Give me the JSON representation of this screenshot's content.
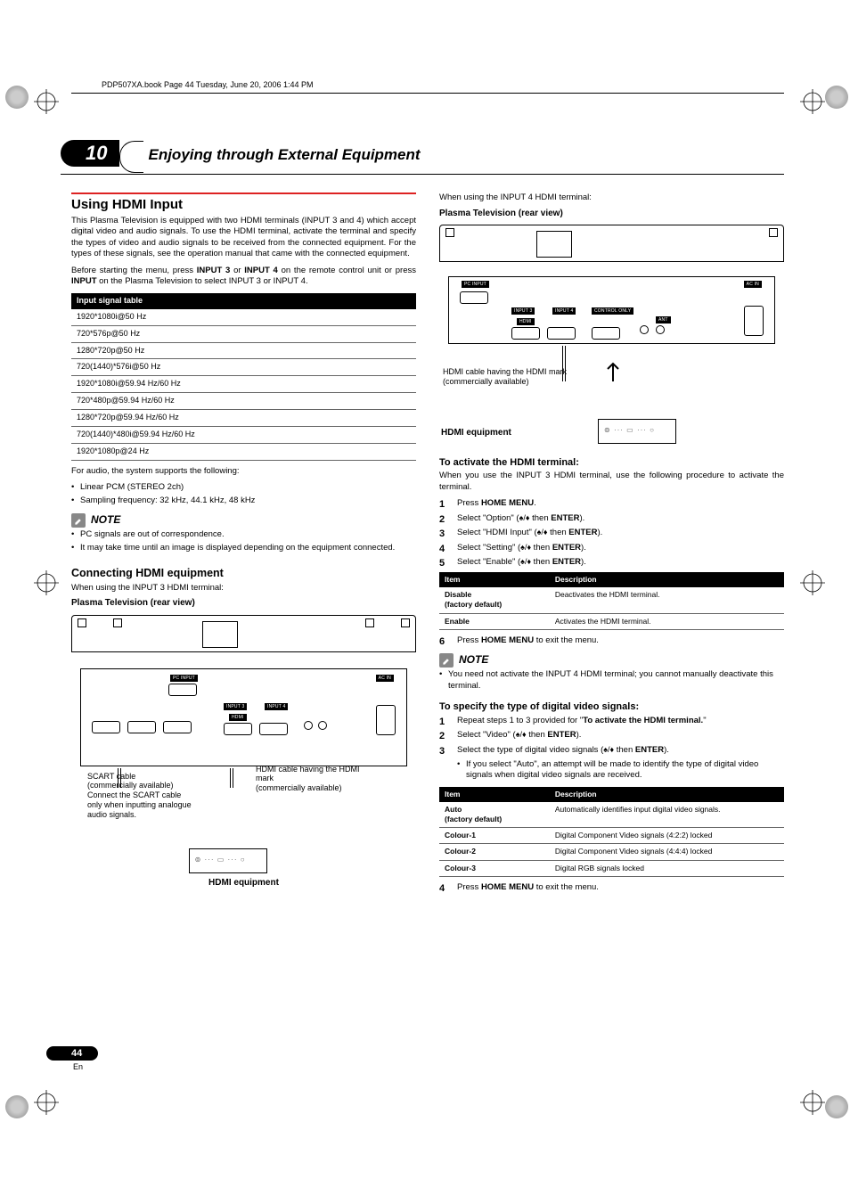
{
  "meta": {
    "tab_line": "PDP507XA.book  Page 44  Tuesday, June 20, 2006  1:44 PM"
  },
  "chapter": {
    "number": "10",
    "title": "Enjoying through External Equipment"
  },
  "left": {
    "h2": "Using HDMI Input",
    "intro": "This Plasma Television is equipped with two HDMI terminals (INPUT 3 and 4) which accept digital video and audio signals. To use the HDMI terminal, activate the terminal and specify the types of video and audio signals to be received from the connected equipment. For the types of these signals, see the operation manual that came with the connected equipment.",
    "before_pre": "Before starting the menu, press ",
    "before_b1": "INPUT 3",
    "before_mid": " or ",
    "before_b2": "INPUT 4",
    "before_mid2": " on the remote control unit or press ",
    "before_b3": "INPUT",
    "before_end": " on the Plasma Television to select INPUT 3 or INPUT 4.",
    "sig_header": "Input signal table",
    "sig_rows": [
      "1920*1080i@50 Hz",
      "720*576p@50 Hz",
      "1280*720p@50 Hz",
      "720(1440)*576i@50 Hz",
      "1920*1080i@59.94 Hz/60 Hz",
      "720*480p@59.94 Hz/60 Hz",
      "1280*720p@59.94 Hz/60 Hz",
      "720(1440)*480i@59.94 Hz/60 Hz",
      "1920*1080p@24 Hz"
    ],
    "after_table": "For audio, the system supports the following:",
    "audio_bullets": [
      "Linear PCM (STEREO 2ch)",
      "Sampling frequency: 32 kHz, 44.1 kHz, 48 kHz"
    ],
    "note_label": "NOTE",
    "note_bullets": [
      "PC signals are out of correspondence.",
      "It may take time until an image is displayed depending on the equipment connected."
    ],
    "h3_connect": "Connecting HDMI equipment",
    "when3": "When using the INPUT 3 HDMI terminal:",
    "diag_caption": "Plasma Television (rear view)",
    "pc_input_lbl": "PC INPUT",
    "input3_lbl": "INPUT 3",
    "input4_lbl": "INPUT 4",
    "hdmi_lbl": "HDMI",
    "acin_lbl": "AC IN",
    "scart_caption": "SCART cable\n(commercially available)\nConnect the SCART cable only when inputting analogue audio signals.",
    "hdmi_caption": "HDMI cable having the HDMI mark\n(commercially available)",
    "equip_caption": "HDMI equipment"
  },
  "right": {
    "when4": "When using the INPUT 4 HDMI terminal:",
    "diag_caption": "Plasma Television (rear view)",
    "hdmi_caption": "HDMI cable having the HDMI mark\n(commercially available)",
    "equip_caption": "HDMI equipment",
    "pc_input_lbl": "PC INPUT",
    "input3_lbl": "INPUT 3",
    "input4_lbl": "INPUT 4",
    "hdmi_lbl": "HDMI",
    "control_lbl": "CONTROL ONLY",
    "ant_lbl": "ANT",
    "acin_lbl": "AC IN",
    "h4_activate": "To activate the HDMI terminal:",
    "activate_intro": "When you use the INPUT 3 HDMI terminal, use the following procedure to activate the terminal.",
    "steps_activate": [
      {
        "pre": "Press ",
        "b1": "HOME MENU",
        "post": "."
      },
      {
        "pre": "Select \"Option\" (",
        "arrows": true,
        "mid": " then ",
        "b1": "ENTER",
        "post": ")."
      },
      {
        "pre": "Select \"HDMI Input\" (",
        "arrows": true,
        "mid": " then ",
        "b1": "ENTER",
        "post": ")."
      },
      {
        "pre": "Select \"Setting\" (",
        "arrows": true,
        "mid": " then ",
        "b1": "ENTER",
        "post": ")."
      },
      {
        "pre": "Select \"Enable\" (",
        "arrows": true,
        "mid": " then ",
        "b1": "ENTER",
        "post": ")."
      }
    ],
    "tbl1_headers": {
      "item": "Item",
      "desc": "Description"
    },
    "tbl1_rows": [
      {
        "k": "Disable\n(factory default)",
        "v": "Deactivates the HDMI terminal."
      },
      {
        "k": "Enable",
        "v": "Activates the HDMI terminal."
      }
    ],
    "step6": {
      "pre": "Press ",
      "b1": "HOME MENU",
      "post": " to exit the menu."
    },
    "note_label": "NOTE",
    "note_bullets": [
      "You need not activate the INPUT 4 HDMI terminal; you cannot manually deactivate this terminal."
    ],
    "h4_video": "To specify the type of digital video signals:",
    "steps_video_1": {
      "pre": "Repeat steps 1 to 3 provided for \"",
      "b1": "To activate the HDMI terminal.",
      "post": "\""
    },
    "steps_video_2": {
      "pre": "Select \"Video\" (",
      "arrows": true,
      "mid": " then ",
      "b1": "ENTER",
      "post": ")."
    },
    "steps_video_3": {
      "pre": "Select the type of digital video signals (",
      "arrows": true,
      "mid": " then ",
      "b1": "ENTER",
      "post": ")."
    },
    "steps_video_3_sub": "If you select \"Auto\", an attempt will be made to identify the type of digital video signals when digital video signals are received.",
    "tbl2_rows": [
      {
        "k": "Auto\n(factory default)",
        "v": "Automatically identifies input digital video signals."
      },
      {
        "k": "Colour-1",
        "v": "Digital Component Video signals (4:2:2) locked"
      },
      {
        "k": "Colour-2",
        "v": "Digital Component Video signals (4:4:4) locked"
      },
      {
        "k": "Colour-3",
        "v": "Digital RGB signals locked"
      }
    ],
    "step4v": {
      "pre": "Press ",
      "b1": "HOME MENU",
      "post": " to exit the menu."
    }
  },
  "footer": {
    "page": "44",
    "lang": "En"
  }
}
